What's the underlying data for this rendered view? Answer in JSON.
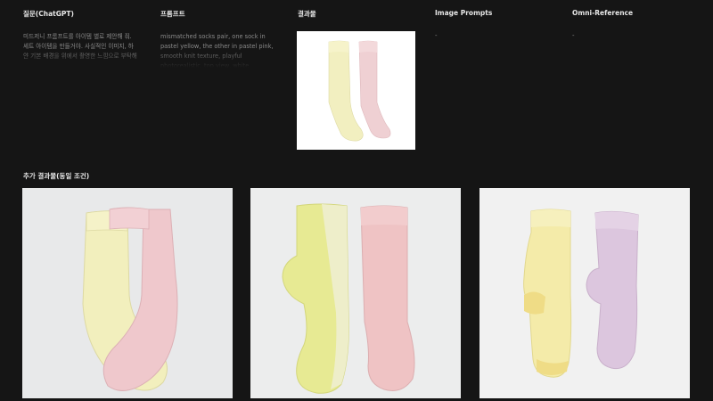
{
  "columns": [
    {
      "title": "질문(ChatGPT)",
      "text": "미드저니 프롬프트를 아이템 별로 제안해 줘. 세트 아이템을 만들거야. 사실적인 이미지, 하얀 기본 배경을 위에서 촬영한 느낌으로 부탁해"
    },
    {
      "title": "프롬프트",
      "text": "mismatched socks pair, one sock in pastel yellow, the other in pastel pink, smooth knit texture, playful photorealistic, top view, white background"
    },
    {
      "title": "결과물"
    },
    {
      "title": "Image Prompts",
      "text": "-"
    },
    {
      "title": "Omni-Reference",
      "text": "-"
    }
  ],
  "additional": {
    "label": "추가 결과물(동일 조건)"
  },
  "colors": {
    "background": "#151515",
    "yellow_sock": "#f2efbd",
    "pink_sock": "#efc9cc",
    "lilac_sock": "#dcc6dc",
    "lemon_sock": "#e8eb8e"
  }
}
